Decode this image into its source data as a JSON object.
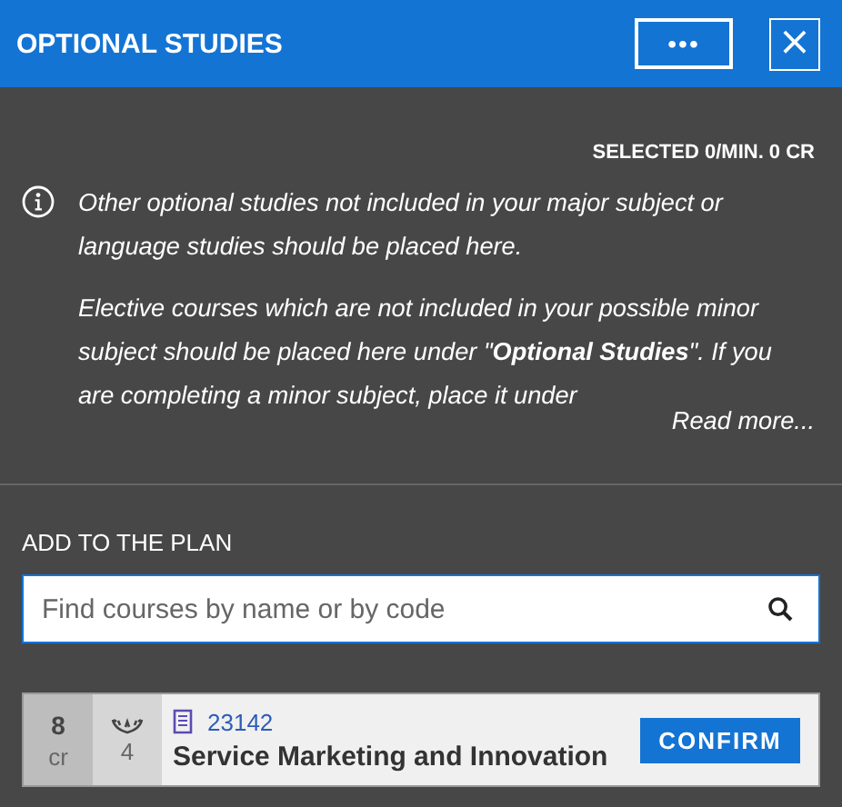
{
  "header": {
    "title": "OPTIONAL STUDIES",
    "more_button": "•••",
    "close_button": "×"
  },
  "selected_summary": "SELECTED 0/MIN. 0 CR",
  "info": {
    "paragraphs": [
      "Other optional studies not included in your major subject or language studies should be placed here.",
      "Elective courses which are not included in your possible minor subject should be placed here under \"**Optional Studies**\". If you are completing a minor subject, place it under"
    ],
    "read_more": "Read more..."
  },
  "add_section": {
    "title": "ADD TO THE PLAN",
    "search": {
      "placeholder": "Find courses by name or by code"
    }
  },
  "courses": [
    {
      "credits": "8",
      "credits_unit": "cr",
      "level": "4",
      "code": "23142",
      "name": "Service Marketing and Innovation",
      "button": "CONFIRM"
    }
  ]
}
